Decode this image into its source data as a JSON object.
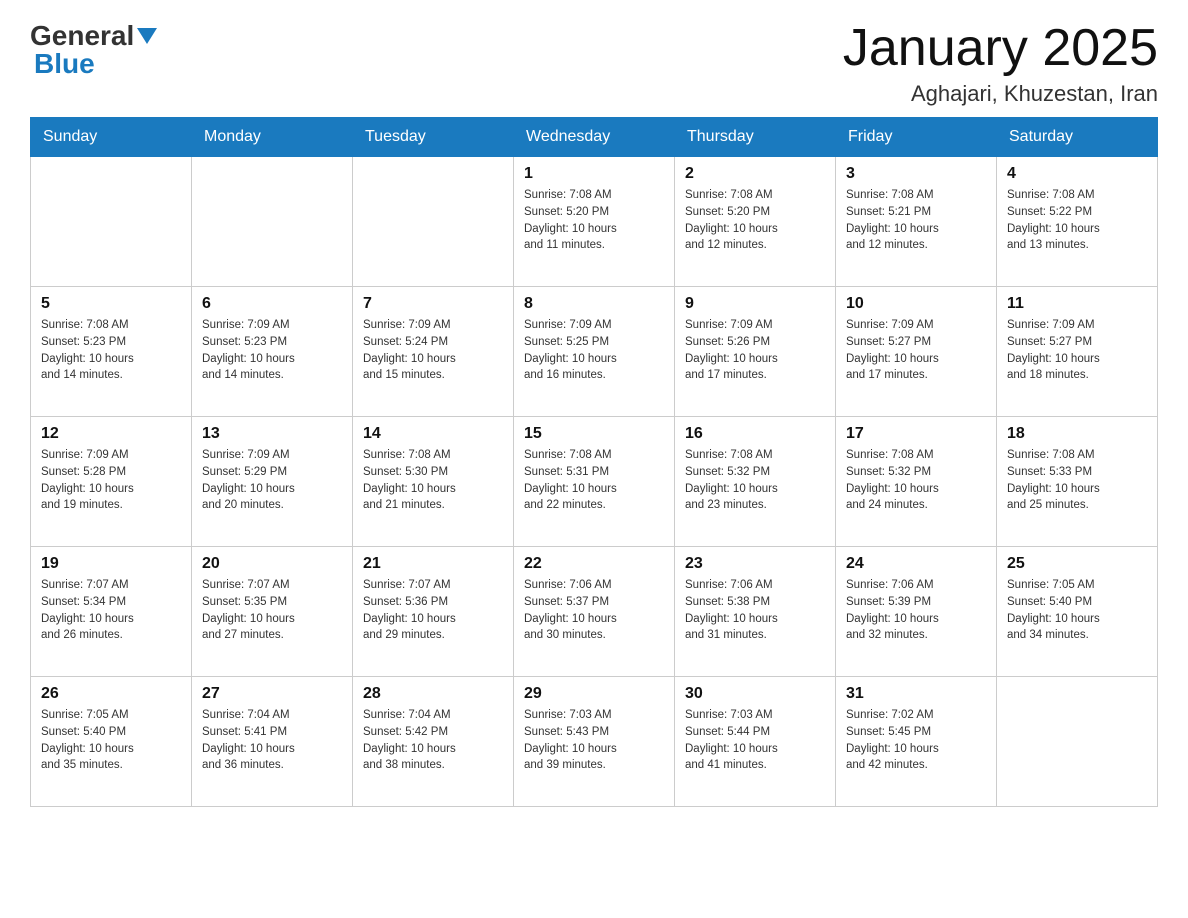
{
  "logo": {
    "general": "General",
    "blue": "Blue"
  },
  "title": "January 2025",
  "subtitle": "Aghajari, Khuzestan, Iran",
  "days_of_week": [
    "Sunday",
    "Monday",
    "Tuesday",
    "Wednesday",
    "Thursday",
    "Friday",
    "Saturday"
  ],
  "weeks": [
    [
      {
        "day": "",
        "info": ""
      },
      {
        "day": "",
        "info": ""
      },
      {
        "day": "",
        "info": ""
      },
      {
        "day": "1",
        "info": "Sunrise: 7:08 AM\nSunset: 5:20 PM\nDaylight: 10 hours\nand 11 minutes."
      },
      {
        "day": "2",
        "info": "Sunrise: 7:08 AM\nSunset: 5:20 PM\nDaylight: 10 hours\nand 12 minutes."
      },
      {
        "day": "3",
        "info": "Sunrise: 7:08 AM\nSunset: 5:21 PM\nDaylight: 10 hours\nand 12 minutes."
      },
      {
        "day": "4",
        "info": "Sunrise: 7:08 AM\nSunset: 5:22 PM\nDaylight: 10 hours\nand 13 minutes."
      }
    ],
    [
      {
        "day": "5",
        "info": "Sunrise: 7:08 AM\nSunset: 5:23 PM\nDaylight: 10 hours\nand 14 minutes."
      },
      {
        "day": "6",
        "info": "Sunrise: 7:09 AM\nSunset: 5:23 PM\nDaylight: 10 hours\nand 14 minutes."
      },
      {
        "day": "7",
        "info": "Sunrise: 7:09 AM\nSunset: 5:24 PM\nDaylight: 10 hours\nand 15 minutes."
      },
      {
        "day": "8",
        "info": "Sunrise: 7:09 AM\nSunset: 5:25 PM\nDaylight: 10 hours\nand 16 minutes."
      },
      {
        "day": "9",
        "info": "Sunrise: 7:09 AM\nSunset: 5:26 PM\nDaylight: 10 hours\nand 17 minutes."
      },
      {
        "day": "10",
        "info": "Sunrise: 7:09 AM\nSunset: 5:27 PM\nDaylight: 10 hours\nand 17 minutes."
      },
      {
        "day": "11",
        "info": "Sunrise: 7:09 AM\nSunset: 5:27 PM\nDaylight: 10 hours\nand 18 minutes."
      }
    ],
    [
      {
        "day": "12",
        "info": "Sunrise: 7:09 AM\nSunset: 5:28 PM\nDaylight: 10 hours\nand 19 minutes."
      },
      {
        "day": "13",
        "info": "Sunrise: 7:09 AM\nSunset: 5:29 PM\nDaylight: 10 hours\nand 20 minutes."
      },
      {
        "day": "14",
        "info": "Sunrise: 7:08 AM\nSunset: 5:30 PM\nDaylight: 10 hours\nand 21 minutes."
      },
      {
        "day": "15",
        "info": "Sunrise: 7:08 AM\nSunset: 5:31 PM\nDaylight: 10 hours\nand 22 minutes."
      },
      {
        "day": "16",
        "info": "Sunrise: 7:08 AM\nSunset: 5:32 PM\nDaylight: 10 hours\nand 23 minutes."
      },
      {
        "day": "17",
        "info": "Sunrise: 7:08 AM\nSunset: 5:32 PM\nDaylight: 10 hours\nand 24 minutes."
      },
      {
        "day": "18",
        "info": "Sunrise: 7:08 AM\nSunset: 5:33 PM\nDaylight: 10 hours\nand 25 minutes."
      }
    ],
    [
      {
        "day": "19",
        "info": "Sunrise: 7:07 AM\nSunset: 5:34 PM\nDaylight: 10 hours\nand 26 minutes."
      },
      {
        "day": "20",
        "info": "Sunrise: 7:07 AM\nSunset: 5:35 PM\nDaylight: 10 hours\nand 27 minutes."
      },
      {
        "day": "21",
        "info": "Sunrise: 7:07 AM\nSunset: 5:36 PM\nDaylight: 10 hours\nand 29 minutes."
      },
      {
        "day": "22",
        "info": "Sunrise: 7:06 AM\nSunset: 5:37 PM\nDaylight: 10 hours\nand 30 minutes."
      },
      {
        "day": "23",
        "info": "Sunrise: 7:06 AM\nSunset: 5:38 PM\nDaylight: 10 hours\nand 31 minutes."
      },
      {
        "day": "24",
        "info": "Sunrise: 7:06 AM\nSunset: 5:39 PM\nDaylight: 10 hours\nand 32 minutes."
      },
      {
        "day": "25",
        "info": "Sunrise: 7:05 AM\nSunset: 5:40 PM\nDaylight: 10 hours\nand 34 minutes."
      }
    ],
    [
      {
        "day": "26",
        "info": "Sunrise: 7:05 AM\nSunset: 5:40 PM\nDaylight: 10 hours\nand 35 minutes."
      },
      {
        "day": "27",
        "info": "Sunrise: 7:04 AM\nSunset: 5:41 PM\nDaylight: 10 hours\nand 36 minutes."
      },
      {
        "day": "28",
        "info": "Sunrise: 7:04 AM\nSunset: 5:42 PM\nDaylight: 10 hours\nand 38 minutes."
      },
      {
        "day": "29",
        "info": "Sunrise: 7:03 AM\nSunset: 5:43 PM\nDaylight: 10 hours\nand 39 minutes."
      },
      {
        "day": "30",
        "info": "Sunrise: 7:03 AM\nSunset: 5:44 PM\nDaylight: 10 hours\nand 41 minutes."
      },
      {
        "day": "31",
        "info": "Sunrise: 7:02 AM\nSunset: 5:45 PM\nDaylight: 10 hours\nand 42 minutes."
      },
      {
        "day": "",
        "info": ""
      }
    ]
  ]
}
